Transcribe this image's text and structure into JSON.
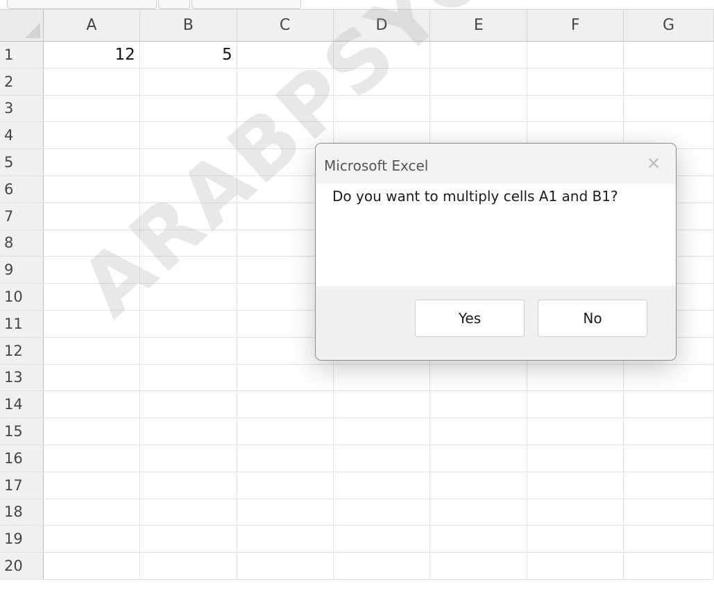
{
  "sheet": {
    "columns": [
      "A",
      "B",
      "C",
      "D",
      "E",
      "F",
      "G"
    ],
    "rows": [
      "1",
      "2",
      "3",
      "4",
      "5",
      "6",
      "7",
      "8",
      "9",
      "10",
      "11",
      "12",
      "13",
      "14",
      "15",
      "16",
      "17",
      "18",
      "19",
      "20"
    ],
    "cells": {
      "A1": "12",
      "B1": "5"
    }
  },
  "dialog": {
    "title": "Microsoft Excel",
    "close_icon": "close-icon",
    "message": "Do you want to multiply cells A1 and B1?",
    "yes_label": "Yes",
    "no_label": "No"
  },
  "watermark": {
    "text": "ARABPSYCHOLOGY"
  }
}
